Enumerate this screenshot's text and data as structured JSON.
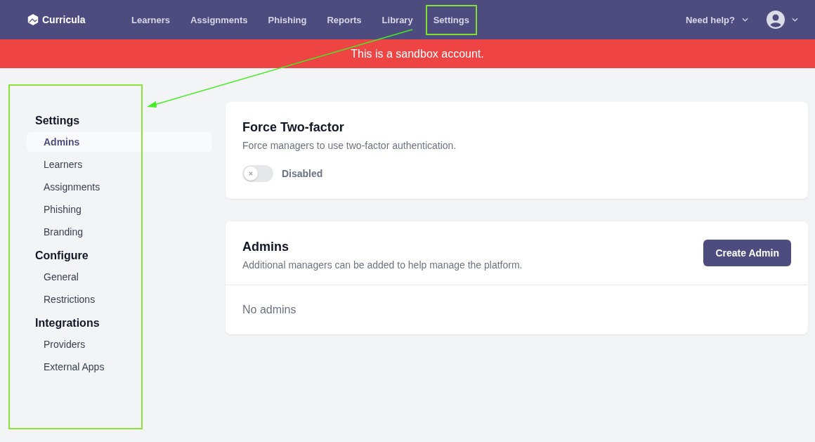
{
  "brand": {
    "name": "Curricula"
  },
  "nav": [
    {
      "label": "Learners",
      "highlighted": false
    },
    {
      "label": "Assignments",
      "highlighted": false
    },
    {
      "label": "Phishing",
      "highlighted": false
    },
    {
      "label": "Reports",
      "highlighted": false
    },
    {
      "label": "Library",
      "highlighted": false
    },
    {
      "label": "Settings",
      "highlighted": true
    }
  ],
  "help": {
    "label": "Need help?"
  },
  "banner": {
    "text": "This is a sandbox account."
  },
  "sidebar": {
    "highlighted": true,
    "groups": [
      {
        "title": "Settings",
        "items": [
          {
            "label": "Admins",
            "selected": true
          },
          {
            "label": "Learners",
            "selected": false
          },
          {
            "label": "Assignments",
            "selected": false
          },
          {
            "label": "Phishing",
            "selected": false
          },
          {
            "label": "Branding",
            "selected": false
          }
        ]
      },
      {
        "title": "Configure",
        "items": [
          {
            "label": "General",
            "selected": false
          },
          {
            "label": "Restrictions",
            "selected": false
          }
        ]
      },
      {
        "title": "Integrations",
        "items": [
          {
            "label": "Providers",
            "selected": false
          },
          {
            "label": "External Apps",
            "selected": false
          }
        ]
      }
    ]
  },
  "annotation_arrow": true,
  "two_factor": {
    "title": "Force Two-factor",
    "description": "Force managers to use two-factor authentication.",
    "on": false,
    "state_label": "Disabled"
  },
  "admins": {
    "title": "Admins",
    "description": "Additional managers can be added to help manage the platform.",
    "button": "Create Admin",
    "empty_text": "No admins"
  }
}
